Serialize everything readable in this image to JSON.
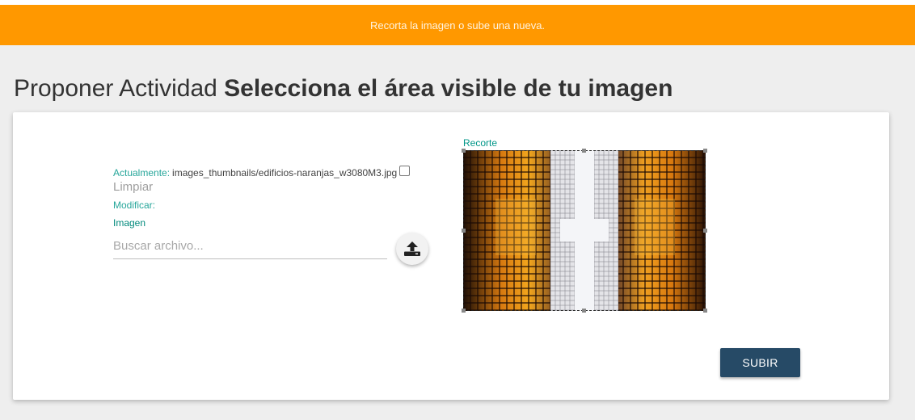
{
  "banner": {
    "message": "Recorta la imagen o sube una nueva."
  },
  "page": {
    "title_light": "Proponer Actividad ",
    "title_bold": "Selecciona el área visible de tu imagen"
  },
  "form": {
    "current_label": "Actualmente:",
    "current_file": "images_thumbnails/edificios-naranjas_w3080M3.jpg",
    "clear_label": "Limpiar",
    "modify_label": "Modificar:",
    "image_label": "Imagen",
    "file_placeholder": "Buscar archivo...",
    "upload_icon": "upload-icon"
  },
  "crop": {
    "label": "Recorte"
  },
  "actions": {
    "submit_label": "SUBIR"
  },
  "colors": {
    "banner": "#ff9800",
    "accent_teal": "#26a69a",
    "submit": "#264a66"
  }
}
